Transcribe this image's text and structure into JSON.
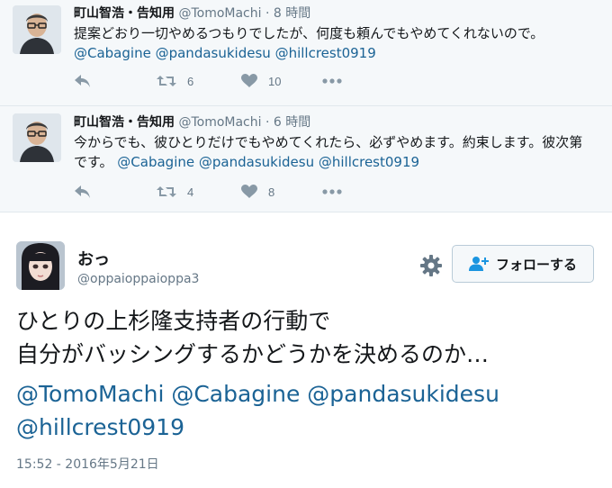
{
  "replies": [
    {
      "author_name": "町山智浩・告知用",
      "author_handle": "@TomoMachi",
      "separator": "·",
      "time": "8 時間",
      "text": "提案どおり一切やめるつもりでしたが、何度も頼んでもやめてくれないので。",
      "mentions": [
        "@Cabagine",
        "@pandasukidesu",
        "@hillcrest0919"
      ],
      "retweet_count": "6",
      "like_count": "10",
      "avatar_icon": "person-glasses-avatar"
    },
    {
      "author_name": "町山智浩・告知用",
      "author_handle": "@TomoMachi",
      "separator": "·",
      "time": "6 時間",
      "text": "今からでも、彼ひとりだけでもやめてくれたら、必ずやめます。約束します。彼次第です。",
      "mentions": [
        "@Cabagine",
        "@pandasukidesu",
        "@hillcrest0919"
      ],
      "retweet_count": "4",
      "like_count": "8",
      "avatar_icon": "person-glasses-avatar"
    }
  ],
  "main_tweet": {
    "author_name": "おっ",
    "author_handle": "@oppaioppaioppa3",
    "follow_label": "フォローする",
    "text_line1": "ひとりの上杉隆支持者の行動で",
    "text_line2": "自分がバッシングするかどうかを決めるのか…",
    "mentions_line1": "@TomoMachi @Cabagine @pandasukidesu",
    "mentions_line2": "@hillcrest0919",
    "timestamp": "15:52 - 2016年5月21日",
    "avatar_icon": "anime-girl-avatar"
  },
  "icons": {
    "reply": "reply-icon",
    "retweet": "retweet-icon",
    "like": "heart-icon",
    "more": "more-dots-icon",
    "gear": "gear-icon",
    "follow": "add-user-icon"
  },
  "colors": {
    "mention": "#1b6395",
    "muted": "#657786",
    "reply_background": "#f5f8fa"
  }
}
